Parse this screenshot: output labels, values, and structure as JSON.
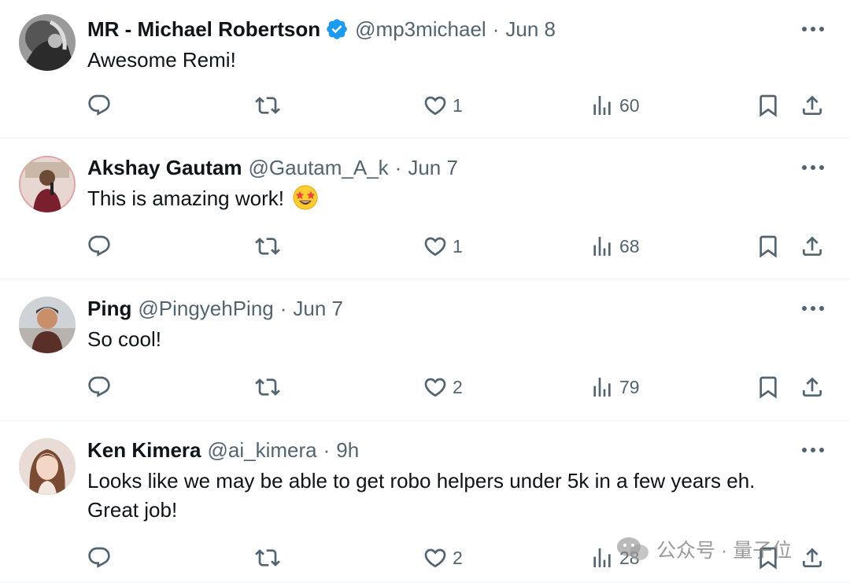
{
  "tweets": [
    {
      "name": "MR - Michael Robertson",
      "verified": true,
      "handle": "@mp3michael",
      "separator": "·",
      "time": "Jun 8",
      "text": "Awesome Remi!",
      "emoji": "",
      "replies": "",
      "retweets": "",
      "likes": "1",
      "views": "60"
    },
    {
      "name": "Akshay Gautam",
      "verified": false,
      "handle": "@Gautam_A_k",
      "separator": "·",
      "time": "Jun 7",
      "text": "This is amazing work!",
      "emoji": "star-struck-emoji",
      "replies": "",
      "retweets": "",
      "likes": "1",
      "views": "68"
    },
    {
      "name": "Ping",
      "verified": false,
      "handle": "@PingyehPing",
      "separator": "·",
      "time": "Jun 7",
      "text": "So cool!",
      "emoji": "",
      "replies": "",
      "retweets": "",
      "likes": "2",
      "views": "79"
    },
    {
      "name": "Ken Kimera",
      "verified": false,
      "handle": "@ai_kimera",
      "separator": "·",
      "time": "9h",
      "text": "Looks like we may be able to get robo helpers under 5k in a few years eh. Great job!",
      "emoji": "",
      "replies": "",
      "retweets": "",
      "likes": "2",
      "views": "28"
    }
  ],
  "icons": {
    "reply": "reply-icon",
    "retweet": "retweet-icon",
    "like": "heart-icon",
    "views": "views-icon",
    "bookmark": "bookmark-icon",
    "share": "share-icon",
    "more": "more-icon",
    "verified": "verified-badge-icon"
  },
  "watermark": {
    "text": "公众号 · 量子位"
  },
  "colors": {
    "text_primary": "#0f1419",
    "text_secondary": "#536471",
    "verified_blue": "#1d9bf0",
    "divider": "#eff3f4"
  }
}
